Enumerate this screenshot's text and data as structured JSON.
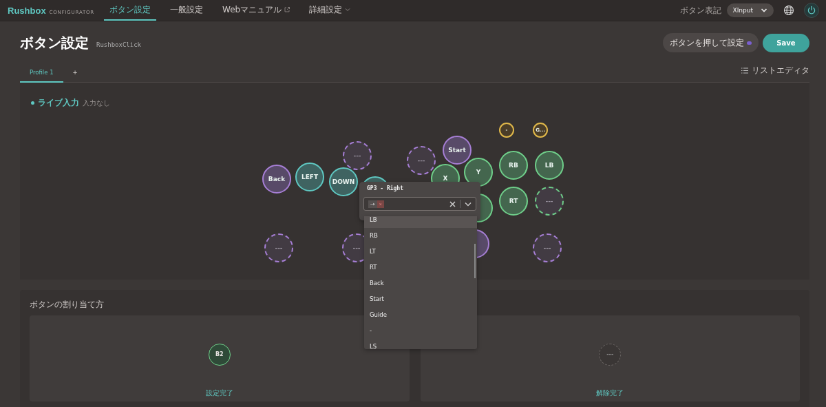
{
  "header": {
    "logo": "Rushbox",
    "logo_sub": "CONFIGURATOR",
    "nav": [
      {
        "label": "ボタン設定",
        "selected": true,
        "kind": "plain"
      },
      {
        "label": "一般設定",
        "selected": false,
        "kind": "plain"
      },
      {
        "label": "Webマニュアル",
        "selected": false,
        "kind": "external"
      },
      {
        "label": "詳細設定",
        "selected": false,
        "kind": "dropdown"
      }
    ],
    "notation_label": "ボタン表記",
    "notation_value": "XInput"
  },
  "page": {
    "title": "ボタン設定",
    "subtitle": "RushboxClick",
    "press_button": "ボタンを押して設定",
    "save": "Save"
  },
  "tabs": [
    {
      "label": "Profile 1",
      "selected": true
    },
    {
      "label": "+",
      "selected": false
    }
  ],
  "list_editor": "リストエディタ",
  "live": {
    "label": "ライブ入力",
    "status": "入力なし"
  },
  "buttons": [
    {
      "label": "Back",
      "kind": "solid",
      "color": "#a77fd6"
    },
    {
      "label": "LEFT",
      "kind": "solid",
      "color": "#5fc8c2"
    },
    {
      "label": "DOWN",
      "kind": "solid",
      "color": "#5fc8c2"
    },
    {
      "kind": "solid",
      "color": "#5fc8c2"
    },
    {
      "label": "---",
      "kind": "dashed",
      "color": "#a77fd6"
    },
    {
      "label": "---",
      "kind": "dashed",
      "color": "#a77fd6"
    },
    {
      "label": "Start",
      "kind": "solid",
      "color": "#a77fd6"
    },
    {
      "label": "X",
      "kind": "solid",
      "color": "#6fcf8a"
    },
    {
      "label": "Y",
      "kind": "solid",
      "color": "#6fcf8a"
    },
    {
      "label": "RB",
      "kind": "solid",
      "color": "#6fcf8a"
    },
    {
      "label": "LB",
      "kind": "solid",
      "color": "#6fcf8a"
    },
    {
      "label": "-",
      "kind": "small",
      "color": "#e0b84a"
    },
    {
      "label": "G...",
      "kind": "small",
      "color": "#e0b84a"
    },
    {
      "kind": "solid",
      "color": "#6fcf8a"
    },
    {
      "label": "RT",
      "kind": "solid",
      "color": "#6fcf8a"
    },
    {
      "label": "---",
      "kind": "dashed",
      "color": "#6fcf8a"
    },
    {
      "label": "---",
      "kind": "dashed",
      "color": "#a77fd6"
    },
    {
      "label": "---",
      "kind": "dashed",
      "color": "#a77fd6"
    },
    {
      "kind": "solid",
      "color": "#a77fd6"
    },
    {
      "label": "---",
      "kind": "dashed",
      "color": "#a77fd6"
    }
  ],
  "popup": {
    "title": "GP3 - Right",
    "chip": "→",
    "chip_remove": "×",
    "options": [
      {
        "label": "LB",
        "selected": true
      },
      {
        "label": "RB",
        "selected": false
      },
      {
        "label": "LT",
        "selected": false
      },
      {
        "label": "RT",
        "selected": false
      },
      {
        "label": "Back",
        "selected": false
      },
      {
        "label": "Start",
        "selected": false
      },
      {
        "label": "Guide",
        "selected": false
      },
      {
        "label": "-",
        "selected": false
      },
      {
        "label": "LS",
        "selected": false
      }
    ]
  },
  "assign": {
    "title": "ボタンの割り当て方",
    "panels": [
      {
        "button": "B2",
        "kind": "solid",
        "caption": "設定完了"
      },
      {
        "button": "---",
        "kind": "dashed",
        "caption": "解除完了"
      }
    ]
  }
}
